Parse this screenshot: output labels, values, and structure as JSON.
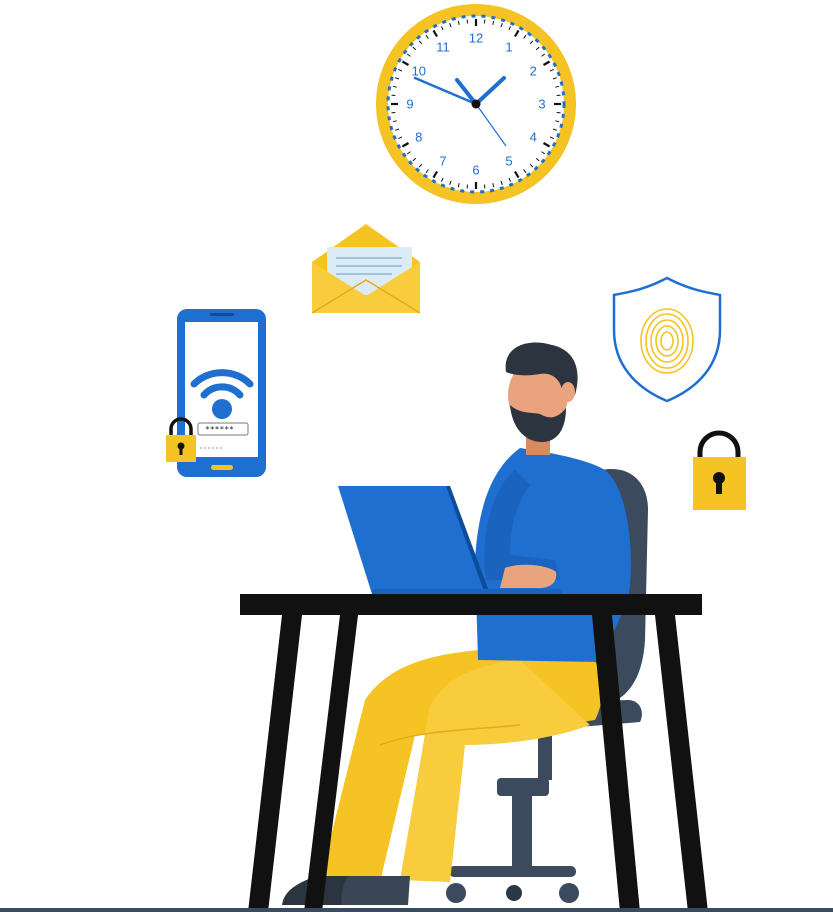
{
  "clock": {
    "numerals": [
      "12",
      "1",
      "2",
      "3",
      "4",
      "5",
      "6",
      "7",
      "8",
      "9",
      "10",
      "11"
    ]
  },
  "phone": {
    "password_mask": "******"
  },
  "colors": {
    "accent_yellow": "#f6c324",
    "accent_blue": "#1f6fd1",
    "dark": "#111111",
    "chair": "#3b4a5c"
  }
}
